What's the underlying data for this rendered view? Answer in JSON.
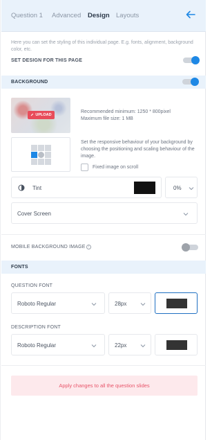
{
  "tabs": [
    {
      "label": "Question 1",
      "active": false
    },
    {
      "label": "Advanced",
      "active": false
    },
    {
      "label": "Design",
      "active": true
    },
    {
      "label": "Layouts",
      "active": false
    }
  ],
  "intro": {
    "text": "Here you can set the styling of this individual page. E.g. fonts, alignment, background color, etc.",
    "toggle_label": "SET DESIGN FOR THIS PAGE",
    "toggle_on": true
  },
  "background": {
    "section_label": "BACKGROUND",
    "toggle_on": true,
    "upload_label": "UPLOAD",
    "recommended": "Recommended minimum: 1250 * 800pixel",
    "max_size": "Maximum file size: 1 MB",
    "position_help": "Set the responsive behaviour of your background by choosing the positioning and scaling behaviour of the image.",
    "fixed_label": "Fixed image on scroll",
    "tint_label": "Tint",
    "tint_color": "#111111",
    "tint_opacity": "0%",
    "scaling_value": "Cover Screen"
  },
  "mobile": {
    "label": "MOBILE BACKGROUND IMAGE",
    "toggle_on": false
  },
  "fonts": {
    "section_label": "FONTS",
    "question_label": "QUESTION FONT",
    "question_font": "Roboto Regular",
    "question_size": "28px",
    "question_color": "#333333",
    "description_label": "DESCRIPTION FONT",
    "description_font": "Roboto Regular",
    "description_size": "22px",
    "description_color": "#333333"
  },
  "apply_label": "Apply changes to all the question slides",
  "colors": {
    "accent": "#1e88e5",
    "tab_bar": "#e9f2fb",
    "upload": "#e84c5a",
    "apply_text": "#e8556a",
    "apply_bg": "#fde9ec"
  },
  "icons": [
    "back-arrow-icon",
    "pencil-icon",
    "tint-icon",
    "chevron-down-icon",
    "info-icon"
  ]
}
